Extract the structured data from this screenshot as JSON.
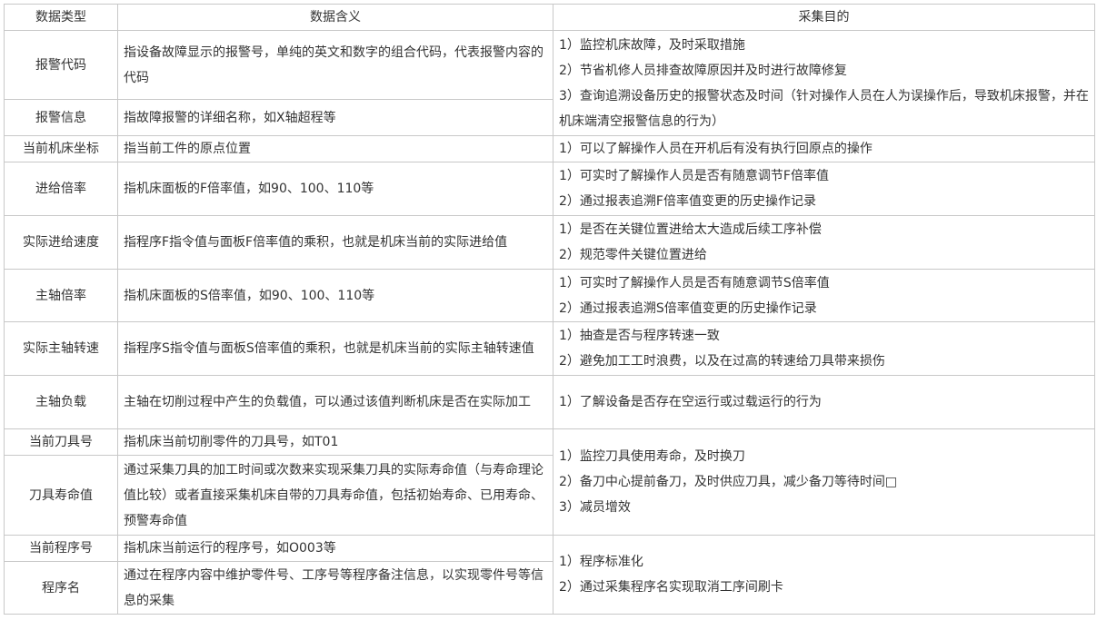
{
  "headers": [
    "数据类型",
    "数据含义",
    "采集目的"
  ],
  "rows": [
    {
      "type": "报警代码",
      "meaning": "指设备故障显示的报警号，单纯的英文和数字的组合代码，代表报警内容的代码"
    },
    {
      "type": "报警信息",
      "meaning": "指故障报警的详细名称，如X轴超程等"
    },
    {
      "type": "当前机床坐标",
      "meaning": "指当前工件的原点位置"
    },
    {
      "type": "进给倍率",
      "meaning": "指机床面板的F倍率值，如90、100、110等"
    },
    {
      "type": "实际进给速度",
      "meaning": "指程序F指令值与面板F倍率值的乘积，也就是机床当前的实际进给值"
    },
    {
      "type": "主轴倍率",
      "meaning": "指机床面板的S倍率值，如90、100、110等"
    },
    {
      "type": "实际主轴转速",
      "meaning": "指程序S指令值与面板S倍率值的乘积，也就是机床当前的实际主轴转速值"
    },
    {
      "type": "主轴负载",
      "meaning": "主轴在切削过程中产生的负载值，可以通过该值判断机床是否在实际加工"
    },
    {
      "type": "当前刀具号",
      "meaning": "指机床当前切削零件的刀具号，如T01"
    },
    {
      "type": "刀具寿命值",
      "meaning": "通过采集刀具的加工时间或次数来实现采集刀具的实际寿命值（与寿命理论值比较）或者直接采集机床自带的刀具寿命值，包括初始寿命、已用寿命、预警寿命值"
    },
    {
      "type": "当前程序号",
      "meaning": "指机床当前运行的程序号，如O003等"
    },
    {
      "type": "程序名",
      "meaning": "通过在程序内容中维护零件号、工序号等程序备注信息，以实现零件号等信息的采集"
    }
  ],
  "purposes": [
    {
      "lines": [
        "1）监控机床故障，及时采取措施",
        "2）节省机修人员排查故障原因并及时进行故障修复",
        "3）查询追溯设备历史的报警状态及时间（针对操作人员在人为误操作后，导致机床报警，并在机床端清空报警信息的行为）"
      ]
    },
    {
      "lines": [
        "1）可以了解操作人员在开机后有没有执行回原点的操作"
      ]
    },
    {
      "lines": [
        "1）可实时了解操作人员是否有随意调节F倍率值",
        "2）通过报表追溯F倍率值变更的历史操作记录"
      ]
    },
    {
      "lines": [
        "1）是否在关键位置进给太大造成后续工序补偿",
        "2）规范零件关键位置进给"
      ]
    },
    {
      "lines": [
        "1）可实时了解操作人员是否有随意调节S倍率值",
        "2）通过报表追溯S倍率值变更的历史操作记录"
      ]
    },
    {
      "lines": [
        "1）抽查是否与程序转速一致",
        "2）避免加工工时浪费，以及在过高的转速给刀具带来损伤"
      ]
    },
    {
      "lines": [
        "1）了解设备是否存在空运行或过载运行的行为"
      ]
    },
    {
      "lines": [
        "1）监控刀具使用寿命，及时换刀",
        "2）备刀中心提前备刀，及时供应刀具，减少备刀等待时间□",
        "3）减员增效"
      ]
    },
    {
      "lines": [
        "1）程序标准化",
        "2）通过采集程序名实现取消工序间刷卡"
      ]
    }
  ]
}
